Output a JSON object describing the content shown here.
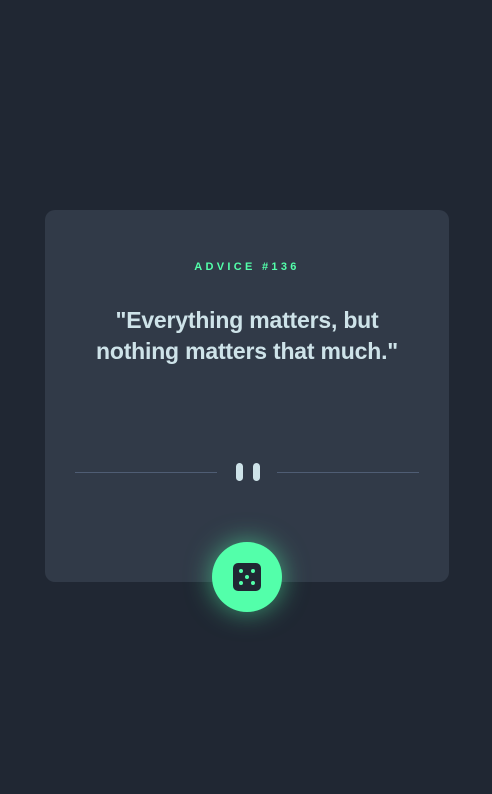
{
  "advice": {
    "label": "ADVICE #136",
    "text": "\"Everything matters, but nothing matters that much.\""
  },
  "theme": {
    "background": "#202733",
    "card": "#313a48",
    "accent": "#53ffaa",
    "text": "#cee3e9",
    "divider": "#4f5d74"
  },
  "icons": {
    "divider_symbol": "pause-icon",
    "action_button": "dice-icon"
  }
}
